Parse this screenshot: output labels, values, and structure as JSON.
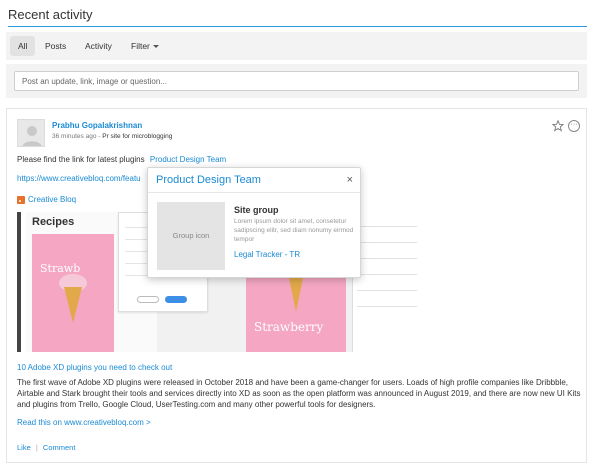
{
  "header": {
    "title": "Recent activity"
  },
  "tabs": [
    {
      "label": "All",
      "active": true
    },
    {
      "label": "Posts",
      "active": false
    },
    {
      "label": "Activity",
      "active": false
    },
    {
      "label": "Filter",
      "active": false,
      "icon": "chevron-down-icon"
    }
  ],
  "postbox": {
    "placeholder": "Post an update, link, image or question..."
  },
  "post": {
    "author": "Prabhu Gopalakrishnan",
    "time": "36 minutes ago",
    "separator": " - ",
    "context": "Pr site for microblogging",
    "text": "Please find the link for latest plugins",
    "mention": "Product Design Team",
    "url": "https://www.creativebloq.com/featu",
    "source": {
      "name": "Creative Bloq",
      "icon": "rss-icon"
    },
    "preview": {
      "recipes": "Recipes",
      "word1": "Strawb",
      "word2": "Strawberry"
    },
    "article_title": "10 Adobe XD plugins you need to check out",
    "article_desc": "The first wave of Adobe XD plugins were released in October 2018 and have been a game-changer for users. Loads of high profile companies like Dribbble, Airtable and Stark brought their tools and services directly into XD as soon as the open platform was announced in August 2019, and there are now new UI Kits and plugins from Trello, Google Cloud, UserTesting.com and many other powerful tools for designers.",
    "read_more": "Read this on www.creativebloq.com >",
    "actions": {
      "like": "Like",
      "separator": "|",
      "comment": "Comment"
    },
    "icons": {
      "star": "star-icon",
      "more": "more-icon"
    }
  },
  "popup": {
    "title": "Product Design Team",
    "close": "×",
    "icon_label": "Group icon",
    "subtitle": "Site group",
    "description": "Lorem ipsum dolor sit amet, consetetur sadipscing elitr, sed diam nonumy eirmod tempor",
    "link": "Legal Tracker - TR"
  },
  "colors": {
    "accent": "#1a8ad4",
    "rule": "#2a9ad8",
    "rss": "#e8712b",
    "pink": "#f4a6c2"
  }
}
